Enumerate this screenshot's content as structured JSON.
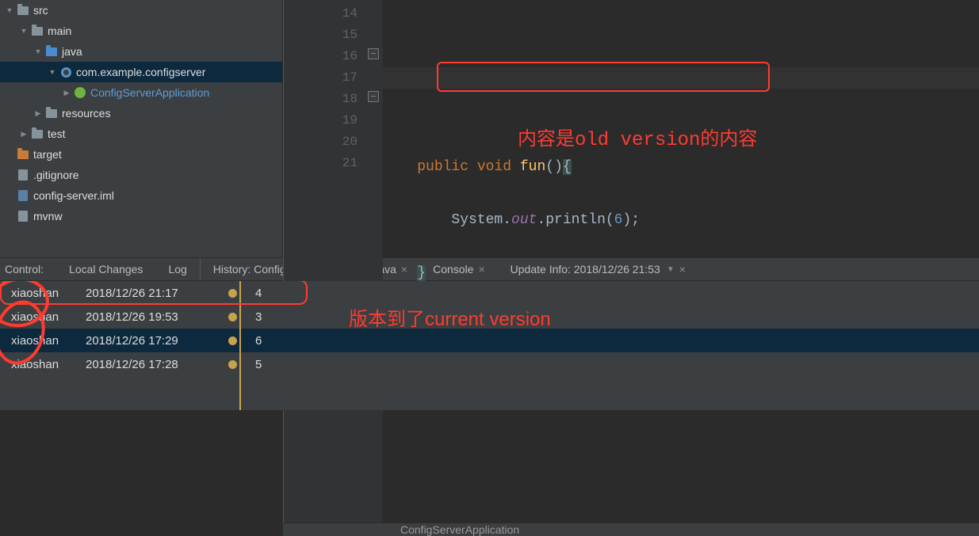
{
  "tree": {
    "src": "src",
    "main": "main",
    "java": "java",
    "package": "com.example.configserver",
    "appClass": "ConfigServerApplication",
    "resources": "resources",
    "test": "test",
    "target": "target",
    "gitignore": ".gitignore",
    "iml": "config-server.iml",
    "mvnw": "mvnw"
  },
  "lineNumbers": [
    "14",
    "15",
    "16",
    "17",
    "18",
    "19",
    "20",
    "21"
  ],
  "code": {
    "kwPublic": "public",
    "kwVoid": "void",
    "fun": "fun",
    "parens": "()",
    "braceOpen": "{",
    "system": "System.",
    "out": "out",
    "println": ".println(",
    "arg": "6",
    "endcall": ");",
    "braceClose": "}",
    "outerClose": "}"
  },
  "breadcrumb": "ConfigServerApplication",
  "toolTabs": {
    "control": "Control:",
    "localChanges": "Local Changes",
    "log": "Log",
    "history": "History: ConfigServerApplication.java",
    "console": "Console",
    "updateInfo": "Update Info: 2018/12/26 21:53"
  },
  "commits": [
    {
      "author": "xiaoshan",
      "date": "2018/12/26 21:17",
      "msg": "4"
    },
    {
      "author": "xiaoshan",
      "date": "2018/12/26 19:53",
      "msg": "3"
    },
    {
      "author": "xiaoshan",
      "date": "2018/12/26 17:29",
      "msg": "6"
    },
    {
      "author": "xiaoshan",
      "date": "2018/12/26 17:28",
      "msg": "5"
    }
  ],
  "annotations": {
    "oldVersion": "内容是old version的内容",
    "currentVersion": "版本到了current version"
  }
}
